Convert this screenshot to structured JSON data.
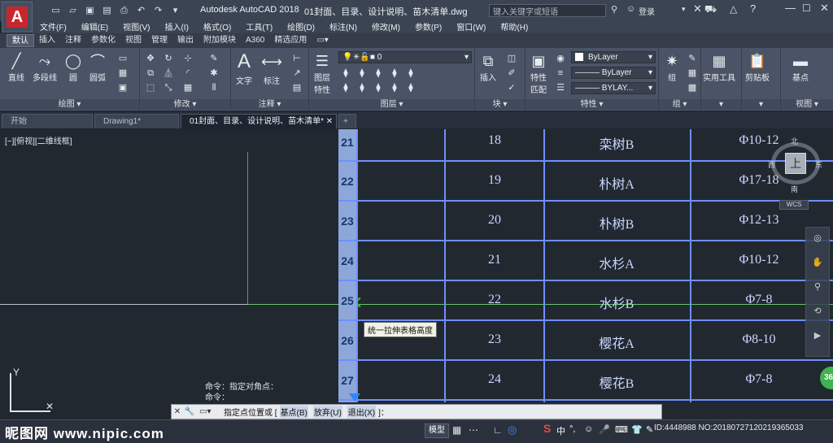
{
  "title_bar": {
    "app_title": "Autodesk AutoCAD 2018",
    "file_title": "01封面、目录、设计说明、苗木清单.dwg",
    "search_placeholder": "键入关键字或短语",
    "login_label": "登录",
    "app_button_letter": "A"
  },
  "menu": [
    "文件(F)",
    "编辑(E)",
    "视图(V)",
    "插入(I)",
    "格式(O)",
    "工具(T)",
    "绘图(D)",
    "标注(N)",
    "修改(M)",
    "参数(P)",
    "窗口(W)",
    "帮助(H)"
  ],
  "ribbon_tabs": [
    "默认",
    "插入",
    "注释",
    "参数化",
    "视图",
    "管理",
    "输出",
    "附加模块",
    "A360",
    "精选应用"
  ],
  "ribbon": {
    "draw": {
      "label": "绘图",
      "line": "直线",
      "polyline": "多段线",
      "circle": "圆",
      "arc": "圆弧"
    },
    "modify": {
      "label": "修改"
    },
    "annotation": {
      "label": "注释",
      "text": "文字",
      "dimension": "标注"
    },
    "layers": {
      "label": "图层",
      "layer_props_1": "图层",
      "layer_props_2": "特性",
      "layer_value": "0"
    },
    "block": {
      "label": "块",
      "insert": "插入"
    },
    "properties": {
      "label": "特性",
      "match_1": "特性",
      "match_2": "匹配",
      "color": "ByLayer",
      "linetype": "ByLayer",
      "lineweight": "BYLAY..."
    },
    "groups": {
      "label": "组",
      "group": "组"
    },
    "utilities": {
      "label": "实用工具"
    },
    "clipboard": {
      "label": "剪贴板"
    },
    "view": {
      "label": "视图",
      "base": "基点"
    }
  },
  "doc_tabs": [
    "开始",
    "Drawing1*",
    "01封面、目录、设计说明、苗木清单*"
  ],
  "viewport_label": "[−][俯视][二维线框]",
  "table": {
    "row_numbers": [
      "21",
      "22",
      "23",
      "24",
      "25",
      "26",
      "27"
    ],
    "rows": [
      {
        "no": "18",
        "name": "栾树B",
        "spec": "Φ10-12"
      },
      {
        "no": "19",
        "name": "朴树A",
        "spec": "Φ17-18"
      },
      {
        "no": "20",
        "name": "朴树B",
        "spec": "Φ12-13"
      },
      {
        "no": "21",
        "name": "水杉A",
        "spec": "Φ10-12"
      },
      {
        "no": "22",
        "name": "水杉B",
        "spec": "Φ7-8"
      },
      {
        "no": "23",
        "name": "樱花A",
        "spec": "Φ8-10"
      },
      {
        "no": "24",
        "name": "樱花B",
        "spec": "Φ7-8"
      }
    ]
  },
  "viewcube": {
    "north": "北",
    "south": "南",
    "west": "西",
    "east": "东",
    "top": "上",
    "wcs": "WCS"
  },
  "tooltip": "统一拉伸表格高度",
  "command": {
    "history_1": "命令：指定对角点：",
    "history_2": "命令：",
    "prompt_pre": "指定点位置或 [",
    "opt_base": "基点(B)",
    "opt_discard": "放弃(U)",
    "opt_exit": "退出(X)",
    "prompt_post": "]："
  },
  "status": {
    "model_label": "模型",
    "watermark_left": "昵图网 www.nipic.com",
    "watermark_right": "ID:4448988 NO:20180727120219365033",
    "badge": "36"
  },
  "colors": {
    "accent": "#c8262d",
    "table_line": "#6f8fff",
    "table_text": "#c9d7ff",
    "row_bar": "#8ea7d8",
    "green_line": "#2fbf2f"
  }
}
